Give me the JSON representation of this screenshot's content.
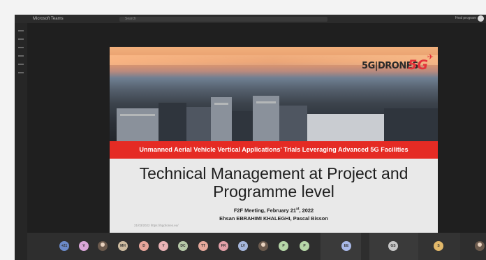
{
  "window": {
    "app_title": "Microsoft Teams",
    "search_placeholder": "Search",
    "profile_label": "Heal program"
  },
  "slide": {
    "logo_text": "5G|DRONES",
    "logo_5g": "5G",
    "banner": "Unmanned Aerial Vehicle Vertical Applications' Trials Leveraging Advanced 5G Facilities",
    "title_line1": "Technical Management at Project and",
    "title_line2": "Programme level",
    "meeting_prefix": "F2F Meeting, February 21",
    "meeting_suffix": "st",
    "meeting_year": ", 2022",
    "authors": "Ehsan EBRAHIMI KHALEGHI, Pascal Bisson",
    "footer": "21/03/2022  https://5gdrones.eu/",
    "brand_red": "#e52b24"
  },
  "participants": [
    {
      "label": "+21",
      "color": "#6b8ac9"
    },
    {
      "label": "V",
      "color": "#d9a6d8"
    },
    {
      "label": "",
      "color": "#6b5a4d",
      "photo": true
    },
    {
      "label": "MH",
      "color": "#cdbba0"
    },
    {
      "label": "D",
      "color": "#e6a59a"
    },
    {
      "label": "Y",
      "color": "#eab3b6"
    },
    {
      "label": "DC",
      "color": "#b6c8a8"
    },
    {
      "label": "TT",
      "color": "#e5a89b"
    },
    {
      "label": "FR",
      "color": "#e3a0a8"
    },
    {
      "label": "LV",
      "color": "#a6b7dc"
    },
    {
      "label": "",
      "color": "#6b5a4d",
      "photo": true
    },
    {
      "label": "P",
      "color": "#b6d7a8"
    },
    {
      "label": "P",
      "color": "#b6d7a8"
    },
    {
      "label": "EE",
      "color": "#a9b9e8"
    },
    {
      "label": "GS",
      "color": "#c7c7c7"
    },
    {
      "label": "S",
      "color": "#e2b86a"
    },
    {
      "label": "",
      "color": "#6b5a4d",
      "photo": true
    }
  ]
}
